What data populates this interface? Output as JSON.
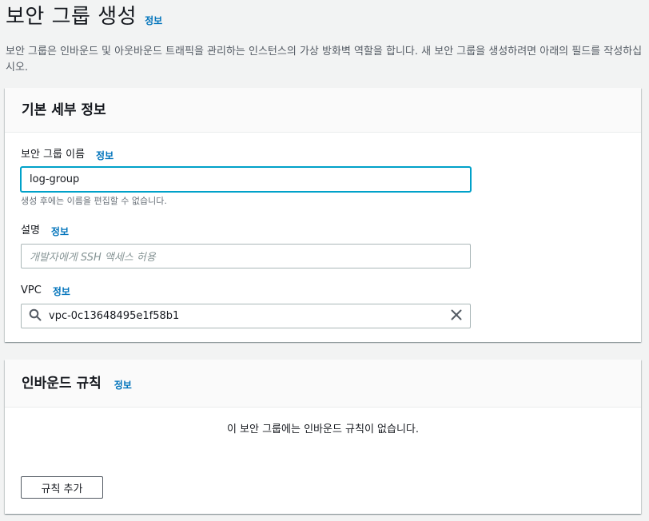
{
  "page": {
    "title": "보안 그룹 생성",
    "info_label": "정보",
    "description": "보안 그룹은 인바운드 및 아웃바운드 트래픽을 관리하는 인스턴스의 가상 방화벽 역할을 합니다. 새 보안 그룹을 생성하려면 아래의 필드를 작성하십시오."
  },
  "basic_details": {
    "header": "기본 세부 정보",
    "name_field": {
      "label": "보안 그룹 이름",
      "info_label": "정보",
      "value": "log-group",
      "hint": "생성 후에는 이름을 편집할 수 없습니다."
    },
    "description_field": {
      "label": "설명",
      "info_label": "정보",
      "placeholder": "개발자에게 SSH 액세스 허용"
    },
    "vpc_field": {
      "label": "VPC",
      "info_label": "정보",
      "value": "vpc-0c13648495e1f58b1",
      "icon": "search-icon",
      "clear_icon": "clear-icon"
    }
  },
  "inbound_rules": {
    "header": "인바운드 규칙",
    "info_label": "정보",
    "empty_message": "이 보안 그룹에는 인바운드 규칙이 없습니다.",
    "add_rule_label": "규칙 추가"
  },
  "colors": {
    "link": "#0073bb",
    "focus": "#00a1c9",
    "background": "#f2f3f3"
  }
}
